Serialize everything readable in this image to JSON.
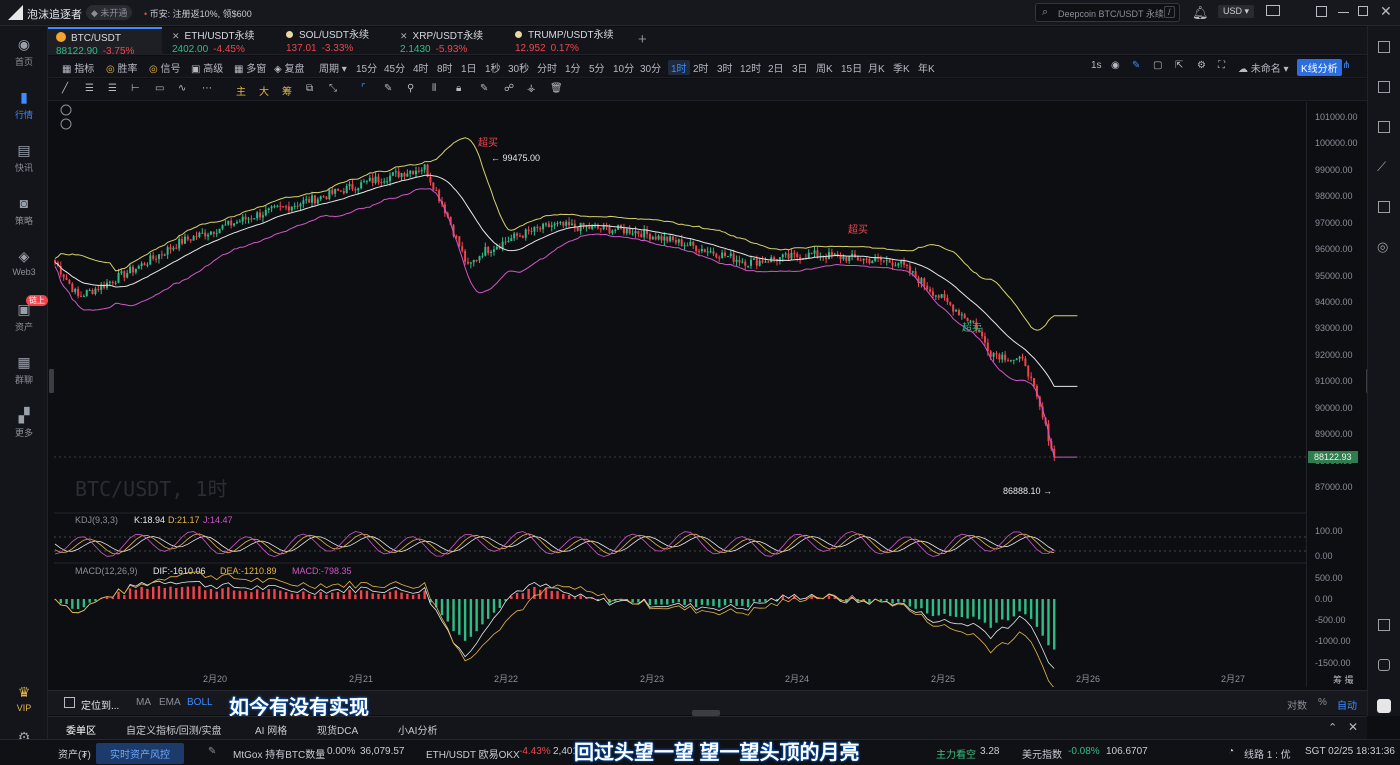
{
  "app": {
    "name": "泡沫追逐者",
    "badge": "未开通",
    "notice": "币安: 注册返10%, 领$600",
    "search_placeholder": "Deepcoin BTC/USDT 永续",
    "search_shortcut": "/",
    "currency": "USD"
  },
  "leftnav": [
    {
      "label": "首页",
      "icon": "home-icon"
    },
    {
      "label": "行情",
      "icon": "market-chart-icon",
      "active": true
    },
    {
      "label": "快讯",
      "icon": "news-icon"
    },
    {
      "label": "策略",
      "icon": "bot-icon"
    },
    {
      "label": "Web3",
      "icon": "web3-icon"
    },
    {
      "label": "资产",
      "icon": "wallet-icon",
      "badge": "链上"
    },
    {
      "label": "群聊",
      "icon": "chat-icon"
    },
    {
      "label": "更多",
      "icon": "more-grid-icon"
    }
  ],
  "vip_label": "VIP",
  "tabs": [
    {
      "symbol": "BTC/USDT",
      "price": "88122.90",
      "change": "-3.75%",
      "price_dir": "dn",
      "change_dir": "up",
      "active": true
    },
    {
      "symbol": "ETH/USDT永续",
      "price": "2402.00",
      "change": "-4.45%",
      "price_dir": "dn",
      "change_dir": "up"
    },
    {
      "symbol": "SOL/USDT永续",
      "price": "137.01",
      "change": "-3.33%",
      "price_dir": "up",
      "change_dir": "up"
    },
    {
      "symbol": "XRP/USDT永续",
      "price": "2.1430",
      "change": "-5.93%",
      "price_dir": "dn",
      "change_dir": "up"
    },
    {
      "symbol": "TRUMP/USDT永续",
      "price": "12.952",
      "change": "0.17%",
      "price_dir": "up",
      "change_dir": "up"
    }
  ],
  "toolbar": {
    "left": [
      "指标",
      "胜率",
      "信号",
      "高级",
      "多窗",
      "复盘",
      "周期"
    ],
    "periods": [
      "15分",
      "45分",
      "4时",
      "8时",
      "1日",
      "1秒",
      "30秒",
      "分时",
      "1分",
      "5分",
      "10分",
      "30分",
      "1时",
      "2时",
      "3时",
      "12时",
      "2日",
      "3日",
      "周K",
      "15日",
      "月K",
      "季K",
      "年K"
    ],
    "active_period": "1时",
    "right_1s": "1s",
    "unnamed": "未命名",
    "kline_button": "K线分析"
  },
  "draw_tools": [
    "主",
    "大",
    "筹"
  ],
  "chart": {
    "watermark": "BTC/USDT, 1时",
    "high_label": "99475.00",
    "low_label": "86888.10",
    "current_price": "88122.93",
    "overbought_1": "超买",
    "overbought_2": "超买",
    "oversold": "超卖",
    "price_ticks": [
      "101000.00",
      "100000.00",
      "99000.00",
      "98000.00",
      "97000.00",
      "96000.00",
      "95000.00",
      "94000.00",
      "93000.00",
      "92000.00",
      "91000.00",
      "90000.00",
      "89000.00",
      "88000.00",
      "87000.00"
    ],
    "kdj": {
      "label": "KDJ(9,3,3)",
      "k": "K:18.94",
      "d": "D:21.17",
      "j": "J:14.47",
      "ticks": [
        "100.00",
        "0.00"
      ]
    },
    "macd": {
      "label": "MACD(12,26,9)",
      "dif": "DIF:-1610.06",
      "dea": "DEA:-1210.89",
      "macd": "MACD:-798.35",
      "ticks": [
        "500.00",
        "0.00",
        "-500.00",
        "-1000.00",
        "-1500.00"
      ]
    },
    "dates": [
      "2月20",
      "2月21",
      "2月22",
      "2月23",
      "2月24",
      "2月25",
      "2月26",
      "2月27"
    ]
  },
  "bottombar": {
    "locate": "定位到...",
    "inds": [
      "MA",
      "EMA",
      "BOLL"
    ],
    "right": [
      "对数",
      "%",
      "自动"
    ],
    "subtitle1": "如今有没有实现"
  },
  "bottomtabs": [
    "委单区",
    "自定义指标/回测/实盘",
    "AI 网格",
    "现货DCA",
    "小AI分析"
  ],
  "statusbar": {
    "assets": "资产(₮)",
    "risk": "实时资产风控",
    "mtgox": "MtGox 持有BTC数量",
    "mtgox_pct": "0.00%",
    "mtgox_val": "36,079.57",
    "eth": "ETH/USDT 欧易OKX",
    "eth_pct": "-4.43%",
    "eth_val": "2,401",
    "subtitle2": "回过头望一望 望一望头顶的月亮",
    "main_pos": "主力看空",
    "main_val": "3.28",
    "dxy": "美元指数",
    "dxy_pct": "-0.08%",
    "dxy_val": "106.6707",
    "line": "线路 1 : 优",
    "time": "SGT 02/25 18:31:36"
  }
}
